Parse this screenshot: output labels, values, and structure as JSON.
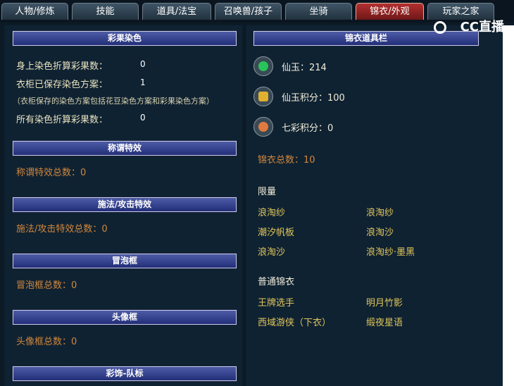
{
  "tabs": [
    {
      "label": "人物/修炼"
    },
    {
      "label": "技能"
    },
    {
      "label": "道具/法宝"
    },
    {
      "label": "召唤兽/孩子"
    },
    {
      "label": "坐骑"
    },
    {
      "label": "锦衣/外观",
      "active": true
    },
    {
      "label": "玩家之家"
    }
  ],
  "watermark": "CC直播",
  "left": {
    "dye": {
      "header": "彩果染色",
      "body_label": "身上染色折算彩果数：",
      "body_value": "0",
      "saved_label": "衣柜已保存染色方案：",
      "saved_value": "1",
      "note": "（衣柜保存的染色方案包括花豆染色方案和彩果染色方案）",
      "total_label": "所有染色折算彩果数：",
      "total_value": "0"
    },
    "title_effect": {
      "header": "称谓特效",
      "text": "称谓特效总数：0"
    },
    "cast_effect": {
      "header": "施法/攻击特效",
      "text": "施法/攻击特效总数：0"
    },
    "bubble": {
      "header": "冒泡框",
      "text": "冒泡框总数：0"
    },
    "avatar": {
      "header": "头像框",
      "text": "头像框总数：0"
    },
    "team": {
      "header": "彩饰-队标"
    }
  },
  "right": {
    "header": "锦衣道具栏",
    "items": [
      {
        "label": "仙玉：214",
        "icon": "jade-icon",
        "color": "#28c45a"
      },
      {
        "label": "仙玉积分：100",
        "icon": "jade-points-icon",
        "color": "#e0b030"
      },
      {
        "label": "七彩积分：0",
        "icon": "rainbow-points-icon",
        "color": "#e07a40"
      }
    ],
    "total": "锦衣总数：10",
    "limited_title": "限量",
    "limited": [
      "浪淘纱",
      "浪淘纱",
      "潮汐帆板",
      "浪淘沙",
      "浪淘沙",
      "浪淘纱·墨黑"
    ],
    "normal_title": "普通锦衣",
    "normal": [
      "王牌选手",
      "明月竹影",
      "西域游侠（下衣）",
      "缎夜星语"
    ]
  }
}
